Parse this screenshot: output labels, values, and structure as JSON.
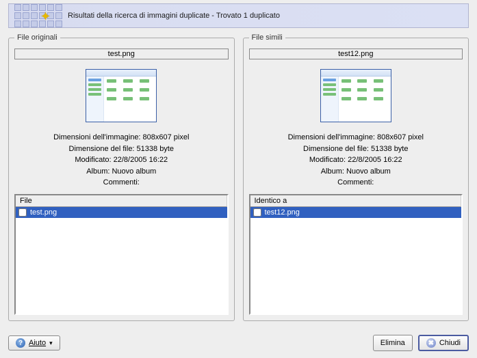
{
  "header": {
    "title": "Risultati della ricerca di immagini duplicate - Trovato 1 duplicato"
  },
  "panels": {
    "left": {
      "legend": "File originali",
      "filename": "test.png",
      "meta": {
        "dimensions": "Dimensioni dell'immagine: 808x607 pixel",
        "filesize": "Dimensione del file: 51338 byte",
        "modified": "Modificato: 22/8/2005 16:22",
        "album": "Album: Nuovo album",
        "comments": "Commenti:"
      },
      "list": {
        "header": "File",
        "item": "test.png"
      }
    },
    "right": {
      "legend": "File simili",
      "filename": "test12.png",
      "meta": {
        "dimensions": "Dimensioni dell'immagine: 808x607 pixel",
        "filesize": "Dimensione del file: 51338 byte",
        "modified": "Modificato: 22/8/2005 16:22",
        "album": "Album: Nuovo album",
        "comments": "Commenti:"
      },
      "list": {
        "header": "Identico a",
        "item": "test12.png"
      }
    }
  },
  "footer": {
    "help": "Aiuto",
    "delete": "Elimina",
    "close": "Chiudi"
  }
}
